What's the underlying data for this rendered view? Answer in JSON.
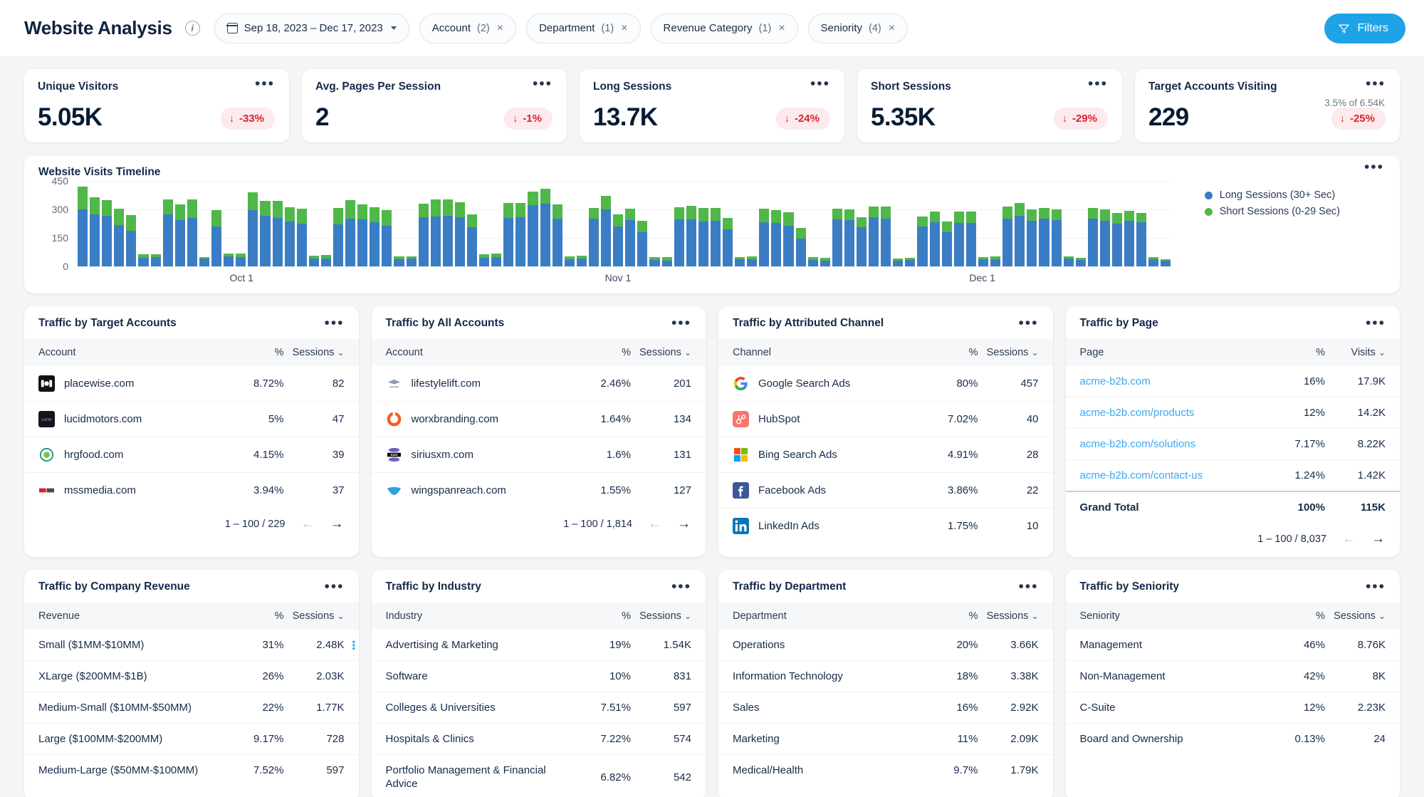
{
  "header": {
    "title": "Website Analysis",
    "info_icon": "info-icon",
    "date_range": "Sep 18, 2023 – Dec 17, 2023",
    "filters_button": "Filters",
    "chips": [
      {
        "label": "Account",
        "count": "(2)"
      },
      {
        "label": "Department",
        "count": "(1)"
      },
      {
        "label": "Revenue Category",
        "count": "(1)"
      },
      {
        "label": "Seniority",
        "count": "(4)"
      }
    ]
  },
  "kpis": [
    {
      "title": "Unique Visitors",
      "value": "5.05K",
      "delta": "-33%",
      "arrow": "↓",
      "sub": ""
    },
    {
      "title": "Avg. Pages Per Session",
      "value": "2",
      "delta": "-1%",
      "arrow": "↓",
      "sub": ""
    },
    {
      "title": "Long Sessions",
      "value": "13.7K",
      "delta": "-24%",
      "arrow": "↓",
      "sub": ""
    },
    {
      "title": "Short Sessions",
      "value": "5.35K",
      "delta": "-29%",
      "arrow": "↓",
      "sub": ""
    },
    {
      "title": "Target Accounts Visiting",
      "value": "229",
      "delta": "-25%",
      "arrow": "↓",
      "sub": "3.5% of 6.54K"
    }
  ],
  "timeline": {
    "title": "Website Visits Timeline",
    "legend": [
      {
        "label": "Long Sessions (30+ Sec)",
        "color": "#3b7dc4"
      },
      {
        "label": "Short Sessions (0-29 Sec)",
        "color": "#4fb848"
      }
    ]
  },
  "chart_data": {
    "type": "bar",
    "title": "Website Visits Timeline",
    "stacked": true,
    "xlabel": "",
    "ylabel": "",
    "ylim": [
      0,
      450
    ],
    "yticks": [
      0,
      150,
      300,
      450
    ],
    "grid": true,
    "legend_position": "right",
    "xtick_labels": [
      "Oct 1",
      "Nov 1",
      "Dec 1"
    ],
    "xtick_indices": [
      13,
      44,
      74
    ],
    "colors": {
      "long": "#3b7dc4",
      "short": "#4fb848"
    },
    "series": [
      {
        "name": "Long Sessions (30+ Sec)",
        "values": [
          299,
          274,
          266,
          217,
          186,
          45,
          47,
          273,
          244,
          256,
          41,
          211,
          51,
          49,
          297,
          268,
          254,
          238,
          225,
          40,
          43,
          223,
          251,
          248,
          232,
          215,
          38,
          41,
          260,
          263,
          268,
          257,
          208,
          45,
          48,
          256,
          257,
          322,
          330,
          252,
          38,
          41,
          250,
          300,
          210,
          245,
          180,
          33,
          31,
          247,
          247,
          235,
          240,
          195,
          36,
          38,
          233,
          228,
          214,
          146,
          34,
          31,
          246,
          244,
          205,
          258,
          250,
          30,
          33,
          209,
          232,
          180,
          228,
          230,
          36,
          38,
          253,
          268,
          240,
          251,
          244,
          41,
          33,
          250,
          240,
          225,
          240,
          232,
          38,
          29
        ]
      },
      {
        "name": "Short Sessions (0-29 Sec)",
        "values": [
          122,
          89,
          84,
          86,
          83,
          17,
          18,
          78,
          81,
          97,
          9,
          85,
          17,
          20,
          93,
          76,
          90,
          74,
          78,
          17,
          17,
          86,
          98,
          80,
          80,
          82,
          13,
          11,
          69,
          91,
          84,
          79,
          65,
          17,
          18,
          78,
          75,
          72,
          78,
          73,
          13,
          14,
          58,
          70,
          64,
          57,
          60,
          14,
          17,
          66,
          70,
          71,
          67,
          60,
          14,
          15,
          71,
          69,
          72,
          58,
          13,
          13,
          58,
          56,
          55,
          57,
          66,
          10,
          13,
          53,
          57,
          55,
          60,
          58,
          13,
          14,
          63,
          64,
          59,
          58,
          56,
          12,
          12,
          57,
          59,
          56,
          54,
          51,
          12,
          10
        ]
      }
    ]
  },
  "panels": {
    "target_accounts": {
      "title": "Traffic by Target Accounts",
      "columns": [
        "Account",
        "%",
        "Sessions"
      ],
      "sort_col": "Sessions",
      "rows": [
        {
          "name": "placewise.com",
          "pct": "8.72%",
          "val": "82",
          "logo": "placewise-logo"
        },
        {
          "name": "lucidmotors.com",
          "pct": "5%",
          "val": "47",
          "logo": "lucidmotors-logo"
        },
        {
          "name": "hrgfood.com",
          "pct": "4.15%",
          "val": "39",
          "logo": "hrgfood-logo"
        },
        {
          "name": "mssmedia.com",
          "pct": "3.94%",
          "val": "37",
          "logo": "mssmedia-logo"
        }
      ],
      "pager": "1 – 100 / 229"
    },
    "all_accounts": {
      "title": "Traffic by All Accounts",
      "columns": [
        "Account",
        "%",
        "Sessions"
      ],
      "sort_col": "Sessions",
      "rows": [
        {
          "name": "lifestylelift.com",
          "pct": "2.46%",
          "val": "201",
          "logo": "lifestylelift-logo"
        },
        {
          "name": "worxbranding.com",
          "pct": "1.64%",
          "val": "134",
          "logo": "worxbranding-logo"
        },
        {
          "name": "siriusxm.com",
          "pct": "1.6%",
          "val": "131",
          "logo": "siriusxm-logo"
        },
        {
          "name": "wingspanreach.com",
          "pct": "1.55%",
          "val": "127",
          "logo": "wingspanreach-logo"
        }
      ],
      "pager": "1 – 100 / 1,814"
    },
    "attributed_channel": {
      "title": "Traffic by Attributed Channel",
      "columns": [
        "Channel",
        "%",
        "Sessions"
      ],
      "sort_col": "Sessions",
      "rows": [
        {
          "name": "Google Search Ads",
          "pct": "80%",
          "val": "457",
          "logo": "google-logo"
        },
        {
          "name": "HubSpot",
          "pct": "7.02%",
          "val": "40",
          "logo": "hubspot-logo"
        },
        {
          "name": "Bing Search Ads",
          "pct": "4.91%",
          "val": "28",
          "logo": "microsoft-logo"
        },
        {
          "name": "Facebook Ads",
          "pct": "3.86%",
          "val": "22",
          "logo": "facebook-logo"
        },
        {
          "name": "LinkedIn Ads",
          "pct": "1.75%",
          "val": "10",
          "logo": "linkedin-logo"
        }
      ]
    },
    "page": {
      "title": "Traffic by Page",
      "columns": [
        "Page",
        "%",
        "Visits"
      ],
      "sort_col": "Visits",
      "rows": [
        {
          "name": "acme-b2b.com",
          "pct": "16%",
          "val": "17.9K"
        },
        {
          "name": "acme-b2b.com/products",
          "pct": "12%",
          "val": "14.2K"
        },
        {
          "name": "acme-b2b.com/solutions",
          "pct": "7.17%",
          "val": "8.22K"
        },
        {
          "name": "acme-b2b.com/contact-us",
          "pct": "1.24%",
          "val": "1.42K"
        }
      ],
      "grand_total": {
        "name": "Grand Total",
        "pct": "100%",
        "val": "115K"
      },
      "pager": "1 – 100 / 8,037"
    },
    "company_revenue": {
      "title": "Traffic by Company Revenue",
      "columns": [
        "Revenue",
        "%",
        "Sessions"
      ],
      "sort_col": "Sessions",
      "rows": [
        {
          "name": "Small ($1MM-$10MM)",
          "pct": "31%",
          "val": "2.48K",
          "menu": true
        },
        {
          "name": "XLarge ($200MM-$1B)",
          "pct": "26%",
          "val": "2.03K"
        },
        {
          "name": "Medium-Small ($10MM-$50MM)",
          "pct": "22%",
          "val": "1.77K"
        },
        {
          "name": "Large ($100MM-$200MM)",
          "pct": "9.17%",
          "val": "728"
        },
        {
          "name": "Medium-Large ($50MM-$100MM)",
          "pct": "7.52%",
          "val": "597"
        }
      ]
    },
    "industry": {
      "title": "Traffic by Industry",
      "columns": [
        "Industry",
        "%",
        "Sessions"
      ],
      "sort_col": "Sessions",
      "rows": [
        {
          "name": "Advertising & Marketing",
          "pct": "19%",
          "val": "1.54K"
        },
        {
          "name": "Software",
          "pct": "10%",
          "val": "831"
        },
        {
          "name": "Colleges & Universities",
          "pct": "7.51%",
          "val": "597"
        },
        {
          "name": "Hospitals & Clinics",
          "pct": "7.22%",
          "val": "574"
        },
        {
          "name": "Portfolio Management & Financial Advice",
          "pct": "6.82%",
          "val": "542",
          "wrap": true
        }
      ]
    },
    "department": {
      "title": "Traffic by Department",
      "columns": [
        "Department",
        "%",
        "Sessions"
      ],
      "sort_col": "Sessions",
      "rows": [
        {
          "name": "Operations",
          "pct": "20%",
          "val": "3.66K"
        },
        {
          "name": "Information Technology",
          "pct": "18%",
          "val": "3.38K"
        },
        {
          "name": "Sales",
          "pct": "16%",
          "val": "2.92K"
        },
        {
          "name": "Marketing",
          "pct": "11%",
          "val": "2.09K"
        },
        {
          "name": "Medical/Health",
          "pct": "9.7%",
          "val": "1.79K"
        }
      ]
    },
    "seniority": {
      "title": "Traffic by Seniority",
      "columns": [
        "Seniority",
        "%",
        "Sessions"
      ],
      "sort_col": "Sessions",
      "rows": [
        {
          "name": "Management",
          "pct": "46%",
          "val": "8.76K"
        },
        {
          "name": "Non-Management",
          "pct": "42%",
          "val": "8K"
        },
        {
          "name": "C-Suite",
          "pct": "12%",
          "val": "2.23K"
        },
        {
          "name": "Board and Ownership",
          "pct": "0.13%",
          "val": "24"
        }
      ]
    }
  }
}
